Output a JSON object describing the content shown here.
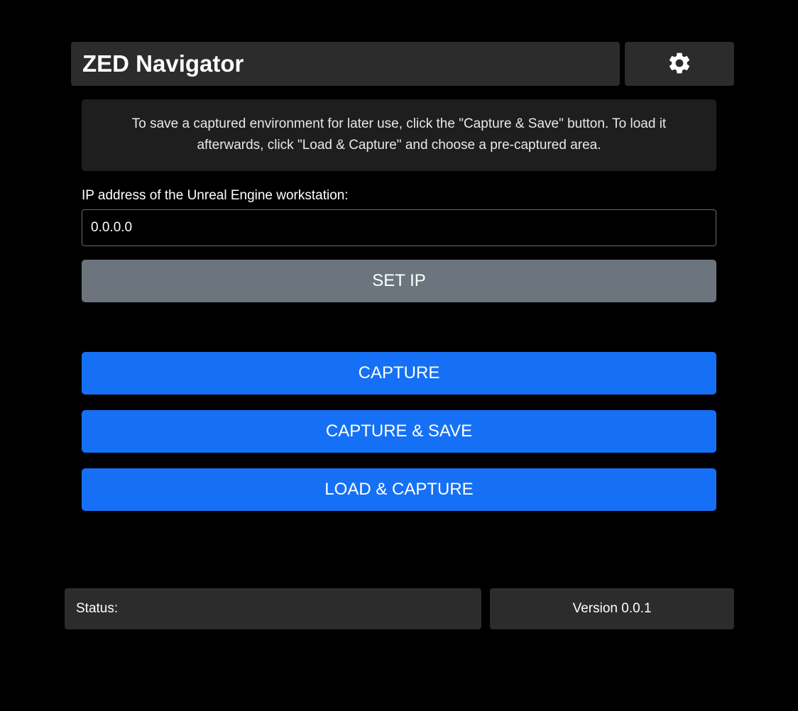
{
  "header": {
    "title": "ZED Navigator"
  },
  "info": {
    "text": "To save a captured environment for later use, click the \"Capture & Save\" button. To load it afterwards, click \"Load & Capture\" and choose a pre-captured area."
  },
  "ip": {
    "label": "IP address of the Unreal Engine workstation:",
    "value": "0.0.0.0"
  },
  "buttons": {
    "set_ip": "SET IP",
    "capture": "CAPTURE",
    "capture_save": "CAPTURE & SAVE",
    "load_capture": "LOAD & CAPTURE"
  },
  "footer": {
    "status_label": "Status:",
    "version": "Version 0.0.1"
  }
}
